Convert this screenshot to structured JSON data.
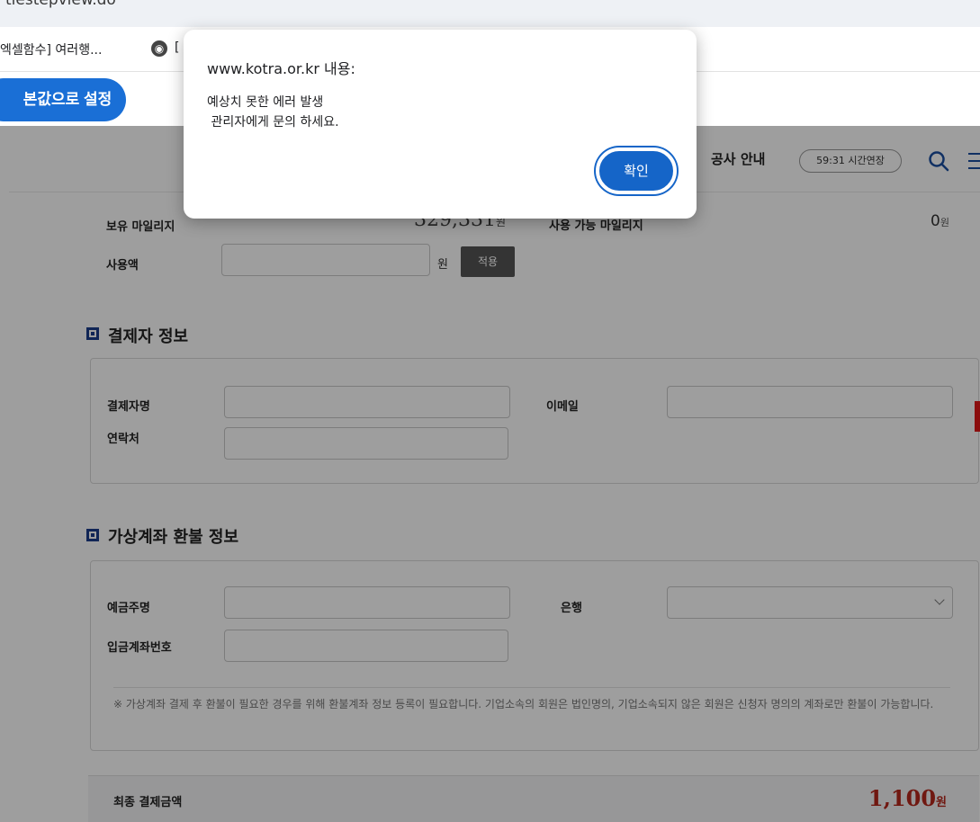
{
  "browser": {
    "url_fragment": "tiestepview.do",
    "bookmarks": [
      {
        "label": "엑셀함수] 여러행..."
      },
      {
        "label": "["
      }
    ],
    "default_setting_button": "본값으로 설정"
  },
  "header": {
    "nav_guide": "공사 안내",
    "timer": "59:31  시간연장"
  },
  "mileage": {
    "held_label": "보유 마일리지",
    "held_value": "329,331",
    "held_unit": "원",
    "available_label": "사용 가능 마일리지",
    "available_value": "0",
    "available_unit": "원",
    "use_label": "사용액",
    "use_unit": "원",
    "apply_button": "적용"
  },
  "payer_section": {
    "title": "결제자 정보",
    "name_label": "결제자명",
    "email_label": "이메일",
    "phone_label": "연락처"
  },
  "refund_section": {
    "title": "가상계좌 환불 정보",
    "holder_label": "예금주명",
    "bank_label": "은행",
    "account_label": "입금계좌번호",
    "notice": "※ 가상계좌 결제 후 환불이 필요한 경우를 위해 환불계좌 정보 등록이 필요합니다. 기업소속의 회원은 법인명의, 기업소속되지 않은 회원은 신청자 명의의 계좌로만 환불이 가능합니다."
  },
  "total": {
    "label": "최종 결제금액",
    "amount": "1,100",
    "unit": "원"
  },
  "dialog": {
    "title": "www.kotra.or.kr 내용:",
    "message": "예상치 못한 에러 발생\n 관리자에게 문의 하세요.",
    "ok_button": "확인"
  },
  "colors": {
    "accent": "#1565c8",
    "total_amount": "#b5281c",
    "section_icon": "#1a3c8c"
  }
}
